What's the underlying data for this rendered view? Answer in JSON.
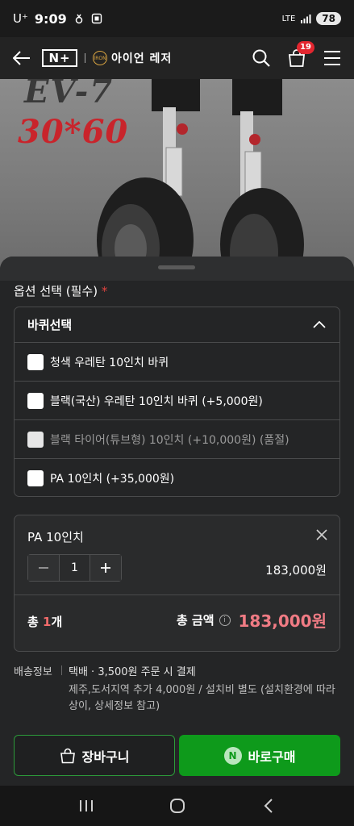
{
  "status_bar": {
    "carrier": "U⁺",
    "time": "9:09",
    "network": "LTE",
    "battery": "78"
  },
  "header": {
    "brand_label": "N+",
    "store_name": "아이언 레저",
    "emblem_text": "IRON",
    "cart_count": "19"
  },
  "product_image": {
    "model_text": "EV-7",
    "size_text": "30*60"
  },
  "options": {
    "title": "옵션 선택 (필수)",
    "required_mark": "*",
    "group_label": "바퀴선택",
    "items": [
      {
        "label": "청색 우레탄 10인치 바퀴",
        "disabled": false
      },
      {
        "label": "블랙(국산) 우레탄 10인치 바퀴 (+5,000원)",
        "disabled": false
      },
      {
        "label": "블랙 타이어(튜브형) 10인치 (+10,000원) (품절)",
        "disabled": true
      },
      {
        "label": "PA 10인치 (+35,000원)",
        "disabled": false
      }
    ]
  },
  "selected": {
    "name": "PA 10인치",
    "quantity": "1",
    "price": "183,000원",
    "total_prefix": "총 ",
    "total_count": "1",
    "total_suffix": "개",
    "total_label": "총 금액",
    "total_amount": "183,000원"
  },
  "shipping": {
    "label": "배송정보",
    "main": "택배 · 3,500원 주문 시 결제",
    "extra": "제주,도서지역 추가 4,000원 / 설치비 별도 (설치환경에 따라 상이, 상세정보 참고)"
  },
  "actions": {
    "cart_label": "장바구니",
    "buy_label": "바로구매",
    "npay_mark": "N"
  },
  "colors": {
    "accent_green": "#0e9a1b",
    "price_pink": "#f07b84",
    "badge_red": "#e3262f"
  }
}
